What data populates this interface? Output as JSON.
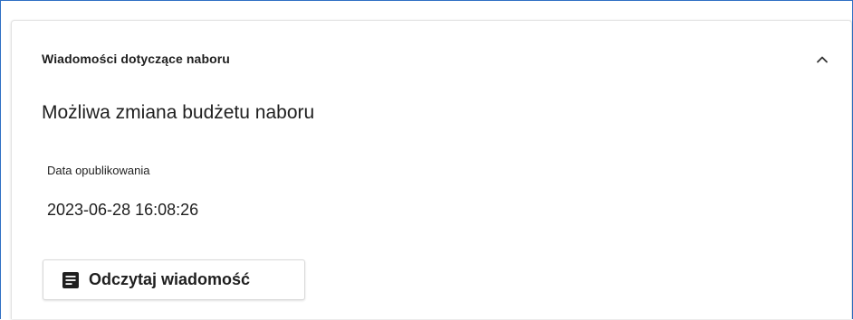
{
  "panel": {
    "header_title": "Wiadomości dotyczące naboru",
    "collapse_icon": "chevron-up-icon",
    "message_title": "Możliwa zmiana budżetu naboru",
    "published_label": "Data opublikowania",
    "published_value": "2023-06-28 16:08:26",
    "read_button_label": "Odczytaj wiadomość",
    "read_button_icon": "article-icon"
  },
  "colors": {
    "frame_border": "#2f6fc4",
    "text": "#1f1f1f"
  }
}
